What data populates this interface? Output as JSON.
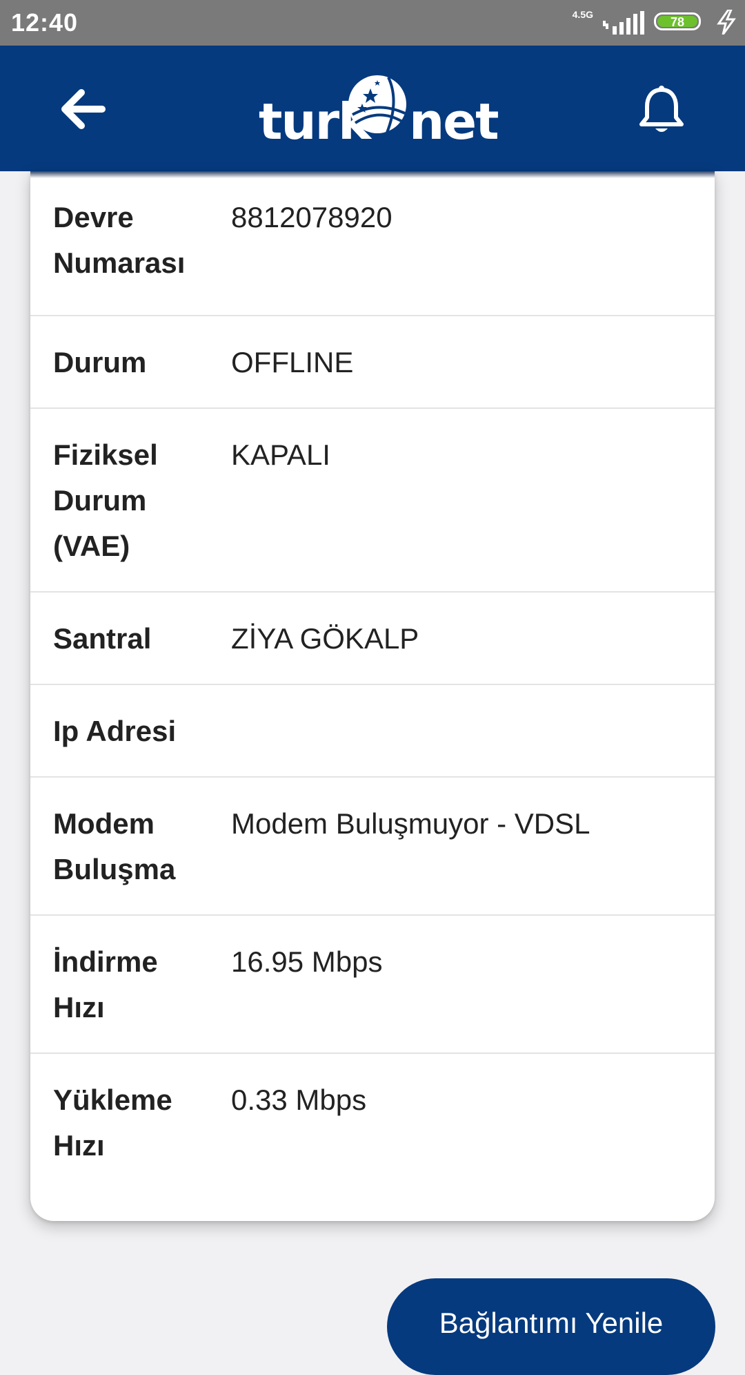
{
  "status_bar": {
    "time": "12:40",
    "network": "4.5G",
    "battery": "78",
    "battery_color": "#6dc12d"
  },
  "app_bar": {
    "logo_left": "turk",
    "logo_right": "net",
    "back_icon": "arrow-left-icon",
    "bell_icon": "bell-icon",
    "color": "#063a7e"
  },
  "details": [
    {
      "label": "Devre Numarası",
      "value": "8812078920"
    },
    {
      "label": "Durum",
      "value": "OFFLINE"
    },
    {
      "label": "Fiziksel Durum (VAE)",
      "value": "KAPALI"
    },
    {
      "label": "Santral",
      "value": "ZİYA GÖKALP"
    },
    {
      "label": "Ip Adresi",
      "value": ""
    },
    {
      "label": "Modem Buluşma",
      "value": "Modem Buluşmuyor - VDSL"
    },
    {
      "label": "İndirme Hızı",
      "value": "16.95 Mbps"
    },
    {
      "label": "Yükleme Hızı",
      "value": "0.33 Mbps"
    }
  ],
  "refresh_button": {
    "label": "Bağlantımı Yenile"
  }
}
